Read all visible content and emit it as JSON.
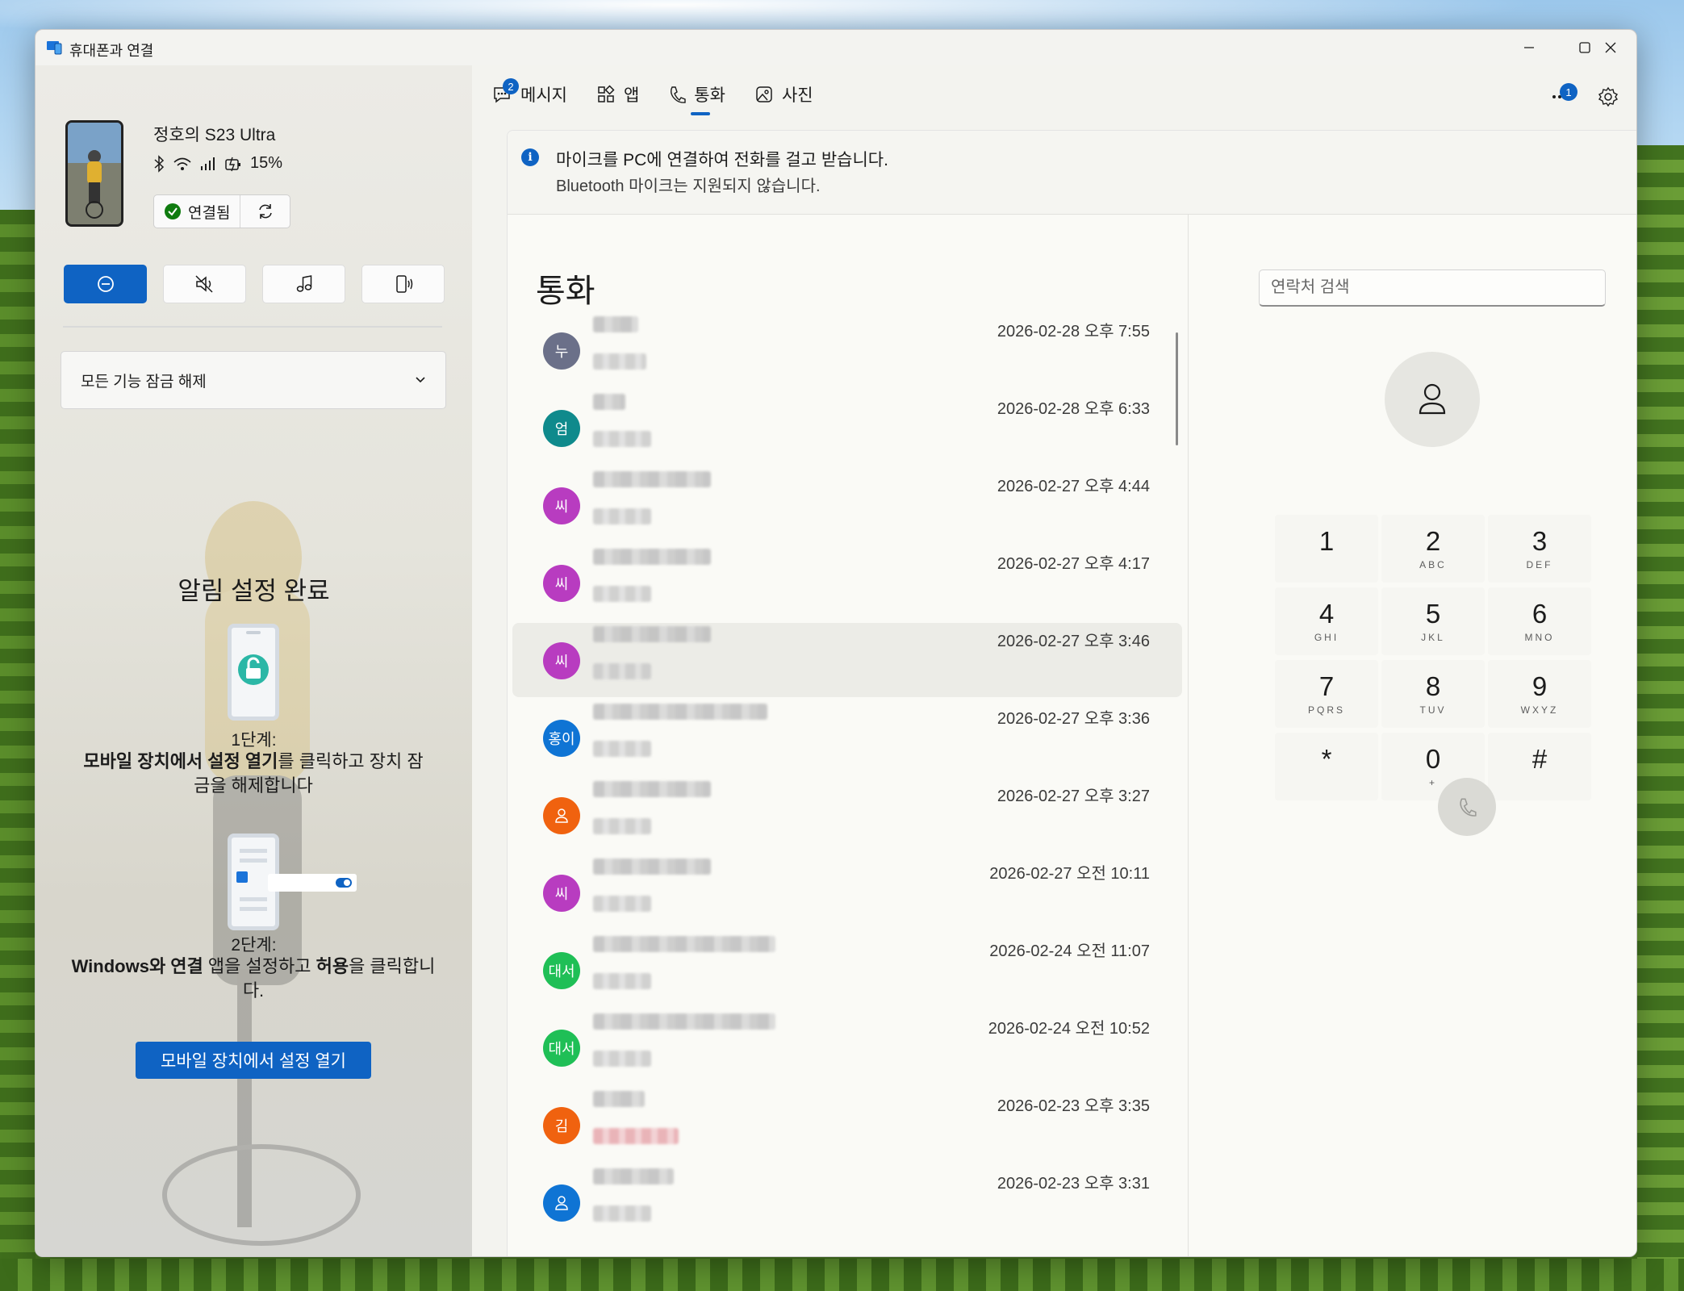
{
  "window": {
    "title": "휴대폰과 연결"
  },
  "device": {
    "name": "정호의 S23 Ultra",
    "battery": "15%",
    "connection_label": "연결됨"
  },
  "left": {
    "unlock_label": "모든 기능 잠금 해제",
    "setup_title": "알림 설정 완료",
    "step1_label": "1단계:",
    "step1_desc_bold1": "모바일 장치에서 설정 열기",
    "step1_desc_rest": "를 클릭하고 장치 잠금을 해제합니다",
    "step2_label": "2단계:",
    "step2_bold1": "Windows와 연결",
    "step2_mid": " 앱을 설정하고 ",
    "step2_bold2": "허용",
    "step2_rest": "을 클릭합니다.",
    "open_button": "모바일 장치에서 설정 열기"
  },
  "tabs": [
    {
      "label": "메시지",
      "badge": "2"
    },
    {
      "label": "앱"
    },
    {
      "label": "통화"
    },
    {
      "label": "사진"
    }
  ],
  "more_badge": "1",
  "info": {
    "line1": "마이크를 PC에 연결하여 전화를 걸고 받습니다.",
    "line2": "Bluetooth 마이크는 지원되지 않습니다."
  },
  "calls": {
    "title": "통화",
    "items": [
      {
        "initial": "누",
        "color": "#6b7089",
        "time": "2026-02-28 오후 7:55"
      },
      {
        "initial": "엄",
        "color": "#0f8a8c",
        "time": "2026-02-28 오후 6:33"
      },
      {
        "initial": "씨",
        "color": "#b83cc0",
        "time": "2026-02-27 오후 4:44"
      },
      {
        "initial": "씨",
        "color": "#b83cc0",
        "time": "2026-02-27 오후 4:17"
      },
      {
        "initial": "씨",
        "color": "#b83cc0",
        "time": "2026-02-27 오후 3:46"
      },
      {
        "initial": "홍이",
        "color": "#0f74d4",
        "time": "2026-02-27 오후 3:36"
      },
      {
        "initial": "",
        "color": "#f0620f",
        "time": "2026-02-27 오후 3:27"
      },
      {
        "initial": "씨",
        "color": "#b83cc0",
        "time": "2026-02-27 오전 10:11"
      },
      {
        "initial": "대서",
        "color": "#1fbf56",
        "time": "2026-02-24 오전 11:07"
      },
      {
        "initial": "대서",
        "color": "#1fbf56",
        "time": "2026-02-24 오전 10:52"
      },
      {
        "initial": "김",
        "color": "#f0620f",
        "time": "2026-02-23 오후 3:35"
      },
      {
        "initial": "",
        "color": "#0f74d4",
        "time": "2026-02-23 오후 3:31"
      }
    ]
  },
  "dialer": {
    "search_placeholder": "연락처 검색",
    "keys": [
      {
        "num": "1",
        "letters": ""
      },
      {
        "num": "2",
        "letters": "ABC"
      },
      {
        "num": "3",
        "letters": "DEF"
      },
      {
        "num": "4",
        "letters": "GHI"
      },
      {
        "num": "5",
        "letters": "JKL"
      },
      {
        "num": "6",
        "letters": "MNO"
      },
      {
        "num": "7",
        "letters": "PQRS"
      },
      {
        "num": "8",
        "letters": "TUV"
      },
      {
        "num": "9",
        "letters": "WXYZ"
      },
      {
        "num": "*",
        "letters": ""
      },
      {
        "num": "0",
        "letters": "+"
      },
      {
        "num": "#",
        "letters": ""
      }
    ]
  },
  "colors": {
    "accent": "#0f63c3",
    "connected": "#0f7b0f"
  }
}
